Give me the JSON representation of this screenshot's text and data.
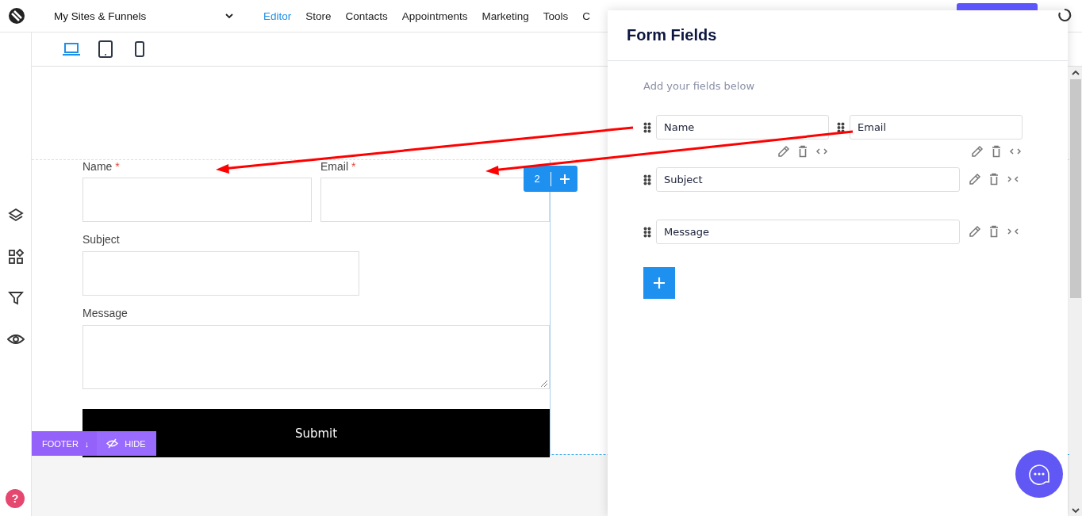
{
  "topbar": {
    "site_menu": "My Sites & Funnels",
    "nav": [
      {
        "label": "Editor",
        "selected": true
      },
      {
        "label": "Store",
        "selected": false
      },
      {
        "label": "Contacts",
        "selected": false
      },
      {
        "label": "Appointments",
        "selected": false
      },
      {
        "label": "Marketing",
        "selected": false
      },
      {
        "label": "Tools",
        "selected": false
      },
      {
        "label": "C",
        "selected": false
      }
    ]
  },
  "devices": [
    {
      "kind": "desktop",
      "selected": true
    },
    {
      "kind": "tablet",
      "selected": false
    },
    {
      "kind": "phone",
      "selected": false
    }
  ],
  "form": {
    "fields": [
      {
        "label": "Name",
        "required_mark": "*",
        "kind": "input"
      },
      {
        "label": "Email",
        "required_mark": "*",
        "kind": "input"
      },
      {
        "label": "Subject",
        "kind": "input"
      },
      {
        "label": "Message",
        "kind": "textarea"
      }
    ],
    "submit": "Submit",
    "column_badge": "2",
    "footer_tag": "FOOTER",
    "footer_arrow": "↓",
    "hide_tag": "HIDE"
  },
  "panel": {
    "title": "Form Fields",
    "hint": "Add your fields below",
    "fields": [
      {
        "label": "Name",
        "full_width": false
      },
      {
        "label": "Email",
        "full_width": false
      },
      {
        "label": "Subject",
        "full_width": true
      },
      {
        "label": "Message",
        "full_width": true
      }
    ]
  },
  "help": "?"
}
